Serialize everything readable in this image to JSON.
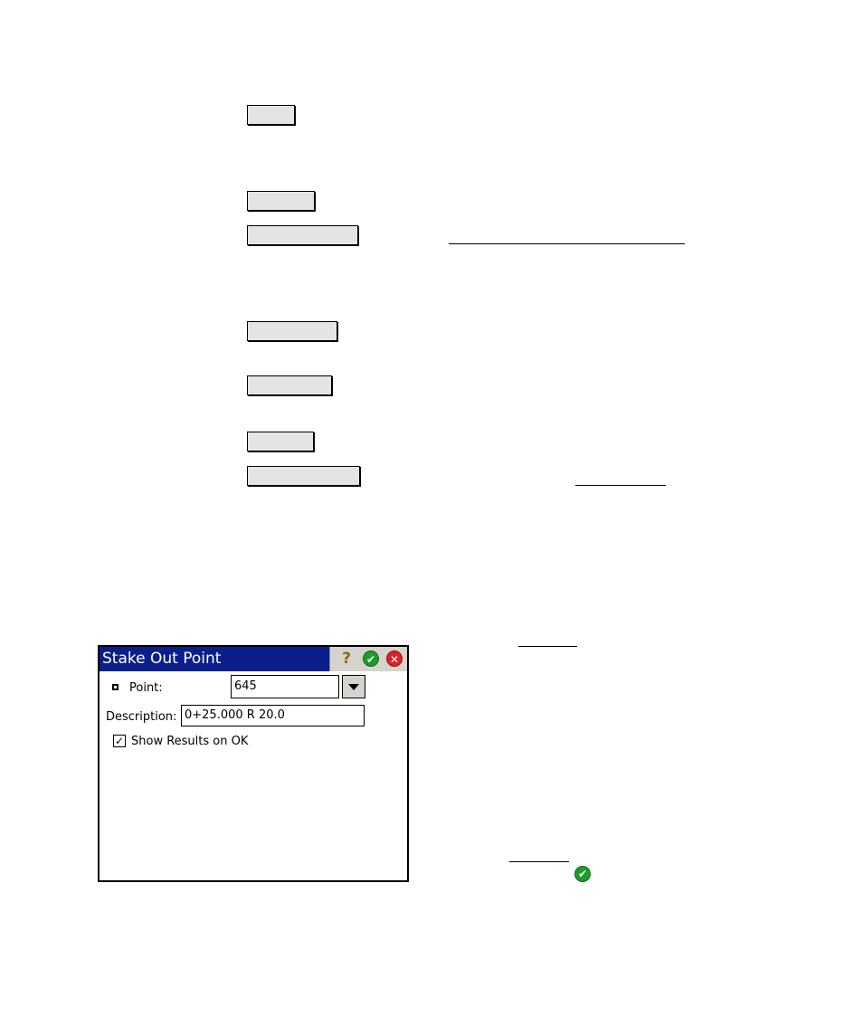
{
  "dialog": {
    "title": "Stake Out Point",
    "point_label": "Point:",
    "point_value": "645",
    "description_label": "Description:",
    "description_value": "0+25.000 R 20.0",
    "show_results_label": "Show Results on OK",
    "show_results_checked": true
  },
  "icons": {
    "help": "help-icon",
    "ok": "ok-icon",
    "close": "close-icon",
    "dropdown": "chevron-down-icon",
    "checkmark": "checkmark-icon"
  },
  "glyphs": {
    "help": "?",
    "ok": "✔",
    "close": "✕",
    "check": "✓"
  },
  "colors": {
    "titlebar": "#0a1e8c",
    "ok_green": "#1f9a2c",
    "close_red": "#d8232a",
    "button_gray": "#e4e4e4"
  }
}
